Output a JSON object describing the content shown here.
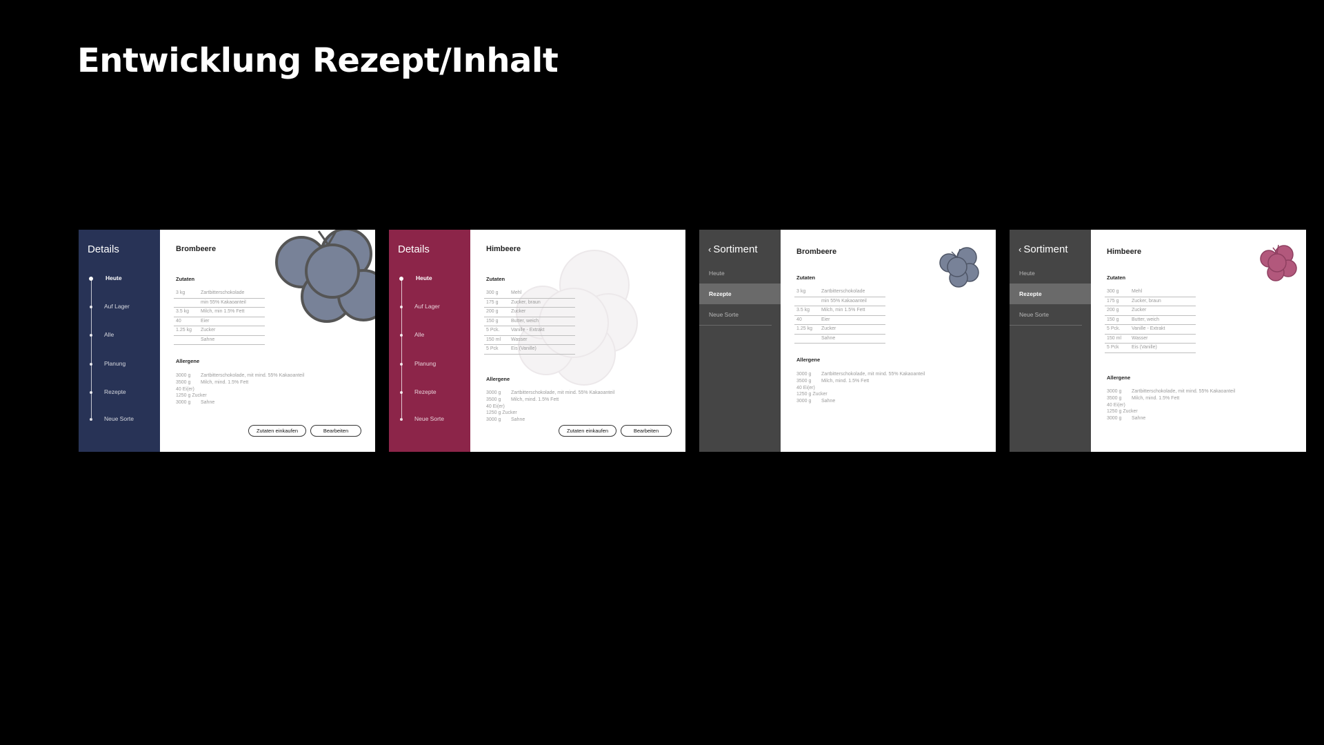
{
  "title": "Entwicklung Rezept/Inhalt",
  "colors": {
    "background": "#000000",
    "navy": "#283356",
    "berry": "#8c2549",
    "dark_gray": "#454545",
    "blackberry_fruit": "#788298",
    "raspberry_fruit": "#b2587c",
    "watermark": "#f5f3f4"
  },
  "screens": [
    {
      "sidebar": {
        "title": "Details",
        "nav": [
          "Heute",
          "Auf Lager",
          "Alle",
          "Planung",
          "Rezepte",
          "Neue Sorte"
        ]
      },
      "fruit_name": "Brombeere",
      "fruit_icon": "blackberry-illustration",
      "zutaten_label": "Zutaten",
      "ingredients": [
        {
          "q": "3 kg",
          "n": "Zartbitterschokolade"
        },
        {
          "q": "",
          "n": "min 55% Kakaoanteil"
        },
        {
          "q": "3.5 kg",
          "n": "Milch, min 1.5% Fett"
        },
        {
          "q": "40",
          "n": "Eier"
        },
        {
          "q": "1.25 kg",
          "n": "Zucker"
        },
        {
          "q": "",
          "n": "Sahne"
        }
      ],
      "allergene_label": "Allergene",
      "allergens": [
        {
          "q": "3000 g",
          "n": "Zartbitterschokolade, mit mind. 55% Kakaoanteil"
        },
        {
          "q": "3500 g",
          "n": "Milch, mind. 1.5% Fett"
        },
        {
          "q": "40 Ei(er)",
          "n": ""
        },
        {
          "q": "1250 g Zucker",
          "n": ""
        },
        {
          "q": "3000 g",
          "n": "Sahne"
        }
      ],
      "buttons": {
        "shop": "Zutaten einkaufen",
        "edit": "Bearbeiten"
      }
    },
    {
      "sidebar": {
        "title": "Details",
        "nav": [
          "Heute",
          "Auf Lager",
          "Alle",
          "Planung",
          "Rezepte",
          "Neue Sorte"
        ]
      },
      "fruit_name": "Himbeere",
      "fruit_icon": "raspberry-watermark",
      "zutaten_label": "Zutaten",
      "ingredients": [
        {
          "q": "300 g",
          "n": "Mehl"
        },
        {
          "q": "175 g",
          "n": "Zucker, braun"
        },
        {
          "q": "200 g",
          "n": "Zucker"
        },
        {
          "q": "150 g",
          "n": "Butter, weich"
        },
        {
          "q": "5 Pck.",
          "n": "Vanille - Extrakt"
        },
        {
          "q": "150 ml",
          "n": "Wasser"
        },
        {
          "q": "5 Pck",
          "n": "Eis (Vanille)"
        }
      ],
      "allergene_label": "Allergene",
      "allergens": [
        {
          "q": "3000 g",
          "n": "Zartbitterschokolade, mit mind. 55% Kakaoanteil"
        },
        {
          "q": "3500 g",
          "n": "Milch, mind. 1.5% Fett"
        },
        {
          "q": "40 Ei(er)",
          "n": ""
        },
        {
          "q": "1250 g Zucker",
          "n": ""
        },
        {
          "q": "3000 g",
          "n": "Sahne"
        }
      ],
      "buttons": {
        "shop": "Zutaten einkaufen",
        "edit": "Bearbeiten"
      }
    },
    {
      "sidebar": {
        "title": "Sortiment",
        "back_icon": "chevron-left-icon",
        "menu": [
          "Heute",
          "Rezepte",
          "Neue Sorte"
        ],
        "active": "Rezepte"
      },
      "fruit_name": "Brombeere",
      "fruit_icon": "blackberry-small-icon",
      "zutaten_label": "Zutaten",
      "ingredients": [
        {
          "q": "3 kg",
          "n": "Zartbitterschokolade"
        },
        {
          "q": "",
          "n": "min 55% Kakaoanteil"
        },
        {
          "q": "3.5 kg",
          "n": "Milch, min 1.5% Fett"
        },
        {
          "q": "40",
          "n": "Eier"
        },
        {
          "q": "1.25 kg",
          "n": "Zucker"
        },
        {
          "q": "",
          "n": "Sahne"
        }
      ],
      "allergene_label": "Allergene",
      "allergens": [
        {
          "q": "3000 g",
          "n": "Zartbitterschokolade, mit mind. 55% Kakaoanteil"
        },
        {
          "q": "3500 g",
          "n": "Milch, mind. 1.5% Fett"
        },
        {
          "q": "40 Ei(er)",
          "n": ""
        },
        {
          "q": "1250 g Zucker",
          "n": ""
        },
        {
          "q": "3000 g",
          "n": "Sahne"
        }
      ]
    },
    {
      "sidebar": {
        "title": "Sortiment",
        "back_icon": "chevron-left-icon",
        "menu": [
          "Heute",
          "Rezepte",
          "Neue Sorte"
        ],
        "active": "Rezepte"
      },
      "fruit_name": "Himbeere",
      "fruit_icon": "raspberry-small-icon",
      "zutaten_label": "Zutaten",
      "ingredients": [
        {
          "q": "300 g",
          "n": "Mehl"
        },
        {
          "q": "175 g",
          "n": "Zucker, braun"
        },
        {
          "q": "200 g",
          "n": "Zucker"
        },
        {
          "q": "150 g",
          "n": "Butter, weich"
        },
        {
          "q": "5 Pck.",
          "n": "Vanille - Extrakt"
        },
        {
          "q": "150 ml",
          "n": "Wasser"
        },
        {
          "q": "5 Pck",
          "n": "Eis (Vanille)"
        }
      ],
      "allergene_label": "Allergene",
      "allergens": [
        {
          "q": "3000 g",
          "n": "Zartbitterschokolade, mit mind. 55% Kakaoanteil"
        },
        {
          "q": "3500 g",
          "n": "Milch, mind. 1.5% Fett"
        },
        {
          "q": "40 Ei(er)",
          "n": ""
        },
        {
          "q": "1250 g Zucker",
          "n": ""
        },
        {
          "q": "3000 g",
          "n": "Sahne"
        }
      ]
    }
  ]
}
